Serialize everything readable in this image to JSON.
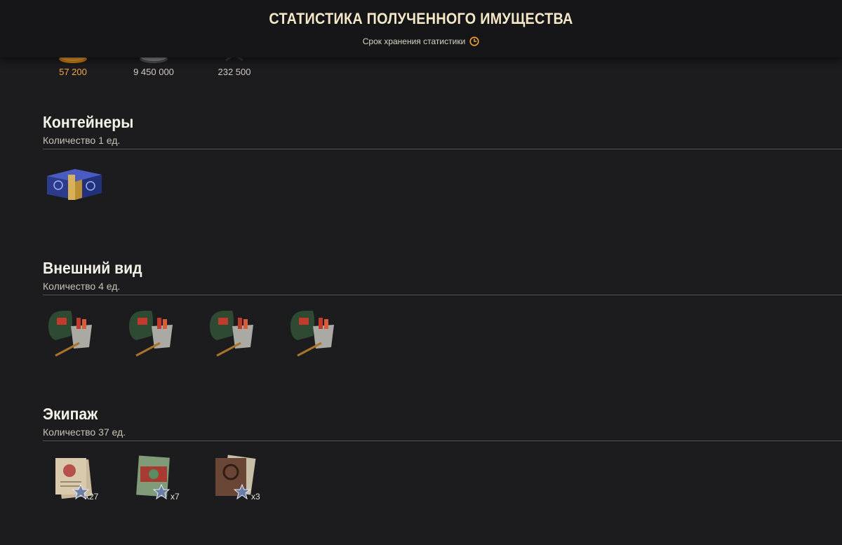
{
  "header": {
    "title": "СТАТИСТИКА ПОЛУЧЕННОГО ИМУЩЕСТВА",
    "subtitle": "Срок хранения статистики",
    "clock_icon": "clock-icon",
    "accent_color": "#f2a23a"
  },
  "resources": [
    {
      "icon": "gold-icon",
      "value": "57 200"
    },
    {
      "icon": "credits-icon",
      "value": "9 450 000"
    },
    {
      "icon": "free-xp-icon",
      "value": "232 500"
    }
  ],
  "sections": {
    "containers": {
      "title": "Контейнеры",
      "count": "Количество 1 ед.",
      "items": [
        {
          "icon": "container-box-icon"
        }
      ]
    },
    "appearance": {
      "title": "Внешний вид",
      "count": "Количество 4 ед.",
      "items": [
        {
          "icon": "camouflage-kit-icon"
        },
        {
          "icon": "camouflage-kit-icon"
        },
        {
          "icon": "camouflage-kit-icon"
        },
        {
          "icon": "camouflage-kit-icon"
        }
      ]
    },
    "crew": {
      "title": "Экипаж",
      "count": "Количество 37 ед.",
      "items": [
        {
          "icon": "crew-books-icon",
          "qty": "x27"
        },
        {
          "icon": "crew-book-icon",
          "qty": "x7"
        },
        {
          "icon": "crew-manual-icon",
          "qty": "x3"
        }
      ]
    }
  }
}
